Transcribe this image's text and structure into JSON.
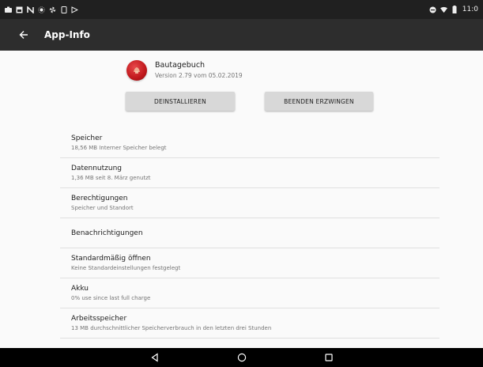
{
  "status_bar": {
    "time": "11:0",
    "left_icons": [
      "camera-icon",
      "image-icon",
      "n-icon",
      "brightness-icon",
      "pinwheel-icon",
      "phone-icon",
      "play-icon"
    ],
    "right_icons": [
      "minus-circle-icon",
      "wifi-icon",
      "battery-icon"
    ]
  },
  "app_bar": {
    "title": "App-Info",
    "back_icon": "arrow-left-icon"
  },
  "app": {
    "name": "Bautagebuch",
    "version": "Version 2.79 vom 05.02.2019",
    "icon": "app-logo-icon",
    "icon_color": "#c0181c"
  },
  "buttons": {
    "uninstall": "DEINSTALLIEREN",
    "force_stop": "BEENDEN ERZWINGEN"
  },
  "settings": [
    {
      "title": "Speicher",
      "subtitle": "18,56 MB Interner Speicher belegt"
    },
    {
      "title": "Datennutzung",
      "subtitle": "1,36 MB seit 8. März genutzt"
    },
    {
      "title": "Berechtigungen",
      "subtitle": "Speicher und Standort"
    },
    {
      "title": "Benachrichtigungen",
      "subtitle": ""
    },
    {
      "title": "Standardmäßig öffnen",
      "subtitle": "Keine Standardeinstellungen festgelegt"
    },
    {
      "title": "Akku",
      "subtitle": "0% use since last full charge"
    },
    {
      "title": "Arbeitsspeicher",
      "subtitle": "13 MB durchschnittlicher Speicherverbrauch in den letzten drei Stunden"
    }
  ],
  "nav_bar": {
    "back": "triangle-back-icon",
    "home": "circle-home-icon",
    "recents": "square-recents-icon"
  },
  "colors": {
    "status_bar": "#202020",
    "app_bar": "#2d2d2d",
    "background": "#fafafa",
    "button": "#d8d8d8",
    "nav_bar": "#000000"
  }
}
